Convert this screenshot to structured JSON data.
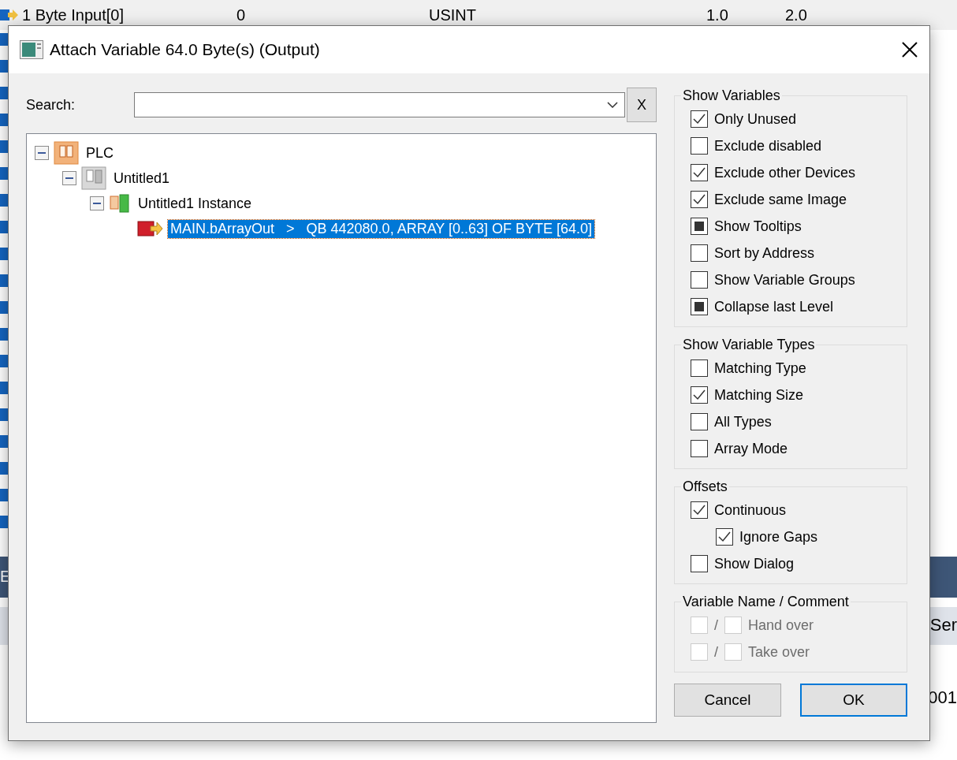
{
  "background": {
    "top_row": [
      "1 Byte Input[0]",
      "0",
      "USINT",
      "1.0",
      "2.0"
    ],
    "panel_header": "E",
    "column_header": "Ser",
    "cell": "001"
  },
  "window": {
    "title": "Attach Variable 64.0 Byte(s) (Output)"
  },
  "search": {
    "label": "Search:",
    "clear_button": "X"
  },
  "tree": [
    {
      "label": "PLC",
      "kind": "plc",
      "expanded": true,
      "selected": false,
      "children": [
        {
          "label": "Untitled1",
          "kind": "project",
          "expanded": true,
          "selected": false,
          "children": [
            {
              "label": "Untitled1 Instance",
              "kind": "instance",
              "expanded": true,
              "selected": false,
              "children": [
                {
                  "label": "MAIN.bArrayOut   >   QB 442080.0, ARRAY [0..63] OF BYTE [64.0]",
                  "kind": "variable",
                  "selected": true
                }
              ]
            }
          ]
        }
      ]
    }
  ],
  "show_variables": {
    "title": "Show Variables",
    "items": [
      {
        "label": "Only Unused",
        "checked": true,
        "indeterminate": false
      },
      {
        "label": "Exclude disabled",
        "checked": false,
        "indeterminate": false
      },
      {
        "label": "Exclude other Devices",
        "checked": true,
        "indeterminate": false
      },
      {
        "label": "Exclude same Image",
        "checked": true,
        "indeterminate": false
      },
      {
        "label": "Show Tooltips",
        "checked": false,
        "indeterminate": true
      },
      {
        "label": "Sort by Address",
        "checked": false,
        "indeterminate": false
      },
      {
        "label": "Show Variable Groups",
        "checked": false,
        "indeterminate": false
      },
      {
        "label": "Collapse last Level",
        "checked": false,
        "indeterminate": true
      }
    ]
  },
  "show_variable_types": {
    "title": "Show Variable Types",
    "items": [
      {
        "label": "Matching Type",
        "checked": false,
        "indeterminate": false
      },
      {
        "label": "Matching Size",
        "checked": true,
        "indeterminate": false
      },
      {
        "label": "All Types",
        "checked": false,
        "indeterminate": false
      },
      {
        "label": "Array Mode",
        "checked": false,
        "indeterminate": false
      }
    ]
  },
  "offsets": {
    "title": "Offsets",
    "items": [
      {
        "label": "Continuous",
        "checked": true,
        "indeterminate": false,
        "children": [
          {
            "label": "Ignore Gaps",
            "checked": true,
            "indeterminate": false
          }
        ]
      },
      {
        "label": "Show Dialog",
        "checked": false,
        "indeterminate": false
      }
    ]
  },
  "variable_name_comment": {
    "title": "Variable Name / Comment",
    "rows": [
      {
        "label": "Hand over",
        "separator": "/",
        "disabled": true,
        "name_checked": false,
        "comment_checked": false
      },
      {
        "label": "Take over",
        "separator": "/",
        "disabled": true,
        "name_checked": false,
        "comment_checked": false
      }
    ]
  },
  "buttons": [
    {
      "label": "Cancel",
      "default": false
    },
    {
      "label": "OK",
      "default": true
    }
  ]
}
